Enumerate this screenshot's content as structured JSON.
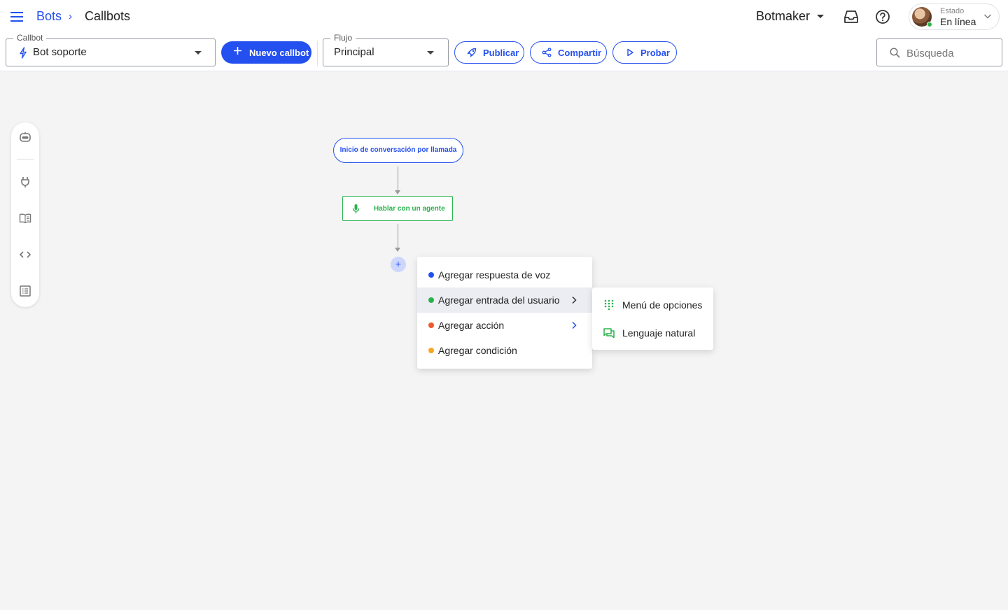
{
  "header": {
    "breadcrumb_root": "Bots",
    "breadcrumb_separator": "›",
    "breadcrumb_current": "Callbots",
    "org_name": "Botmaker",
    "status_label": "Estado",
    "status_value": "En línea"
  },
  "toolbar": {
    "callbot_legend": "Callbot",
    "callbot_value": "Bot soporte",
    "new_callbot_label": "Nuevo callbot",
    "flow_legend": "Flujo",
    "flow_value": "Principal",
    "publish_label": "Publicar",
    "share_label": "Compartir",
    "test_label": "Probar",
    "search_placeholder": "Búsqueda"
  },
  "sidebar": {
    "icons": [
      "bot-icon",
      "plug-icon",
      "book-icon",
      "code-icon",
      "list-icon"
    ]
  },
  "flow": {
    "start_node": "Inicio de conversación por llamada",
    "agent_node": "Hablar con un agente",
    "add_symbol": "+"
  },
  "context_menu": {
    "items": [
      {
        "label": "Agregar respuesta de voz",
        "dot_color": "#2450f0",
        "has_submenu": false
      },
      {
        "label": "Agregar entrada del usuario",
        "dot_color": "#2bb24c",
        "has_submenu": true
      },
      {
        "label": "Agregar acción",
        "dot_color": "#f0582d",
        "has_submenu": true
      },
      {
        "label": "Agregar condición",
        "dot_color": "#f5a623",
        "has_submenu": false
      }
    ],
    "submenu": [
      {
        "label": "Menú de opciones",
        "icon": "dialpad-icon"
      },
      {
        "label": "Lenguaje natural",
        "icon": "chat-icon"
      }
    ]
  },
  "colors": {
    "accent": "#2450f0",
    "success": "#2bb24c",
    "action": "#f0582d",
    "condition": "#f5a623",
    "canvas": "#f4f4f5"
  }
}
